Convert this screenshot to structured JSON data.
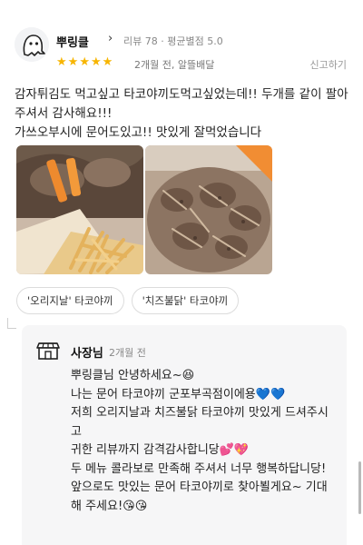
{
  "review": {
    "nickname": "뿌링클",
    "review_count": "리뷰 78",
    "avg_rating": "평균별점 5.0",
    "separator": "·",
    "rating": 5,
    "date_delivery": "2개월 전, 알뜰배달",
    "report": "신고하기",
    "text": "감자튀김도 먹고싶고 타코야끼도먹고싶었는데!! 두개를 같이 팔아주셔서 감사해요!!!\n가쓰오부시에 문어도있고!! 맛있게 잘먹었습니다",
    "tags": [
      "'오리지날' 타코야끼",
      "'치즈불닭' 타코야끼"
    ]
  },
  "reply": {
    "owner": "사장님",
    "date": "2개월 전",
    "lines": [
      "뿌링클님 안녕하세요~😆",
      "나는 문어 타코야끼 군포부곡점이에용💙💙",
      "저희 오리지날과 치즈불닭 타코야끼 맛있게 드셔주시고",
      "귀한 리뷰까지 감격감사합니당💕💖",
      "두 메뉴 콜라보로 만족해 주셔서 너무 행복하답니당!",
      "앞으로도 맛있는 문어 타코야끼로 찾아뵐게요~ 기대해 주세요!😘😘"
    ]
  },
  "colors": {
    "star": "#f7b500",
    "reply_bg": "#f6f6f7",
    "tag_border": "#dcdcdc"
  },
  "icons": {
    "avatar": "ghost-avatar-icon",
    "chevron": "chevron-right-icon",
    "star": "star-icon",
    "shop": "storefront-icon"
  }
}
